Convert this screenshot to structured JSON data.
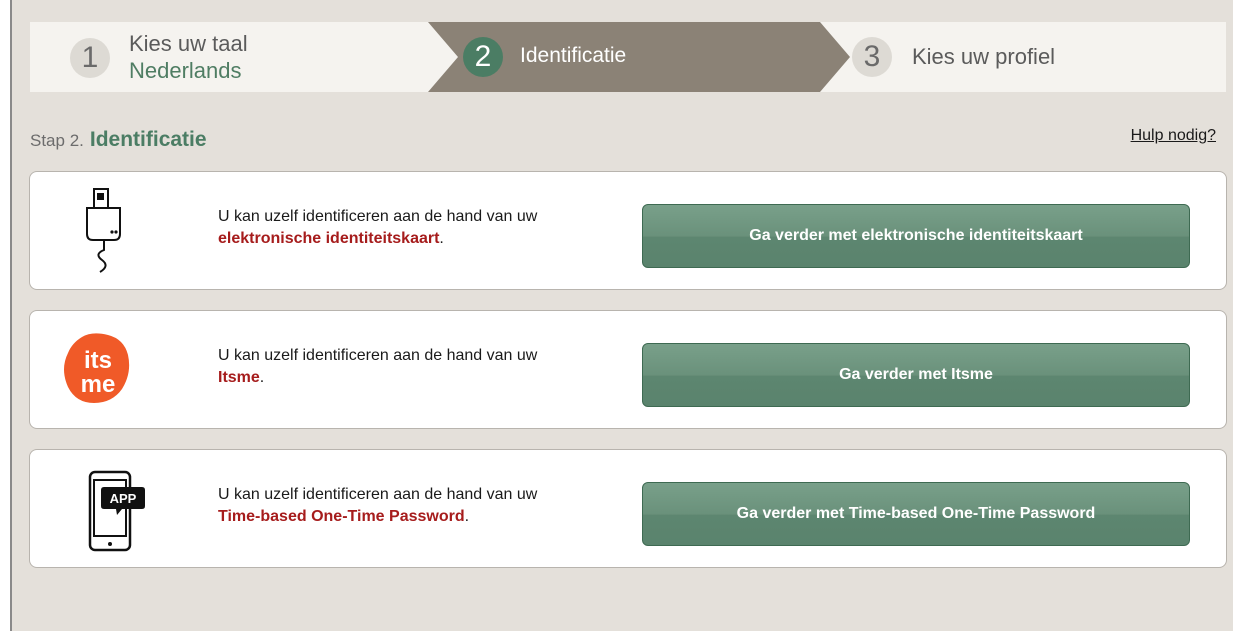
{
  "stepper": {
    "step1": {
      "number": "1",
      "label": "Kies uw taal",
      "value": "Nederlands"
    },
    "step2": {
      "number": "2",
      "label": "Identificatie"
    },
    "step3": {
      "number": "3",
      "label": "Kies uw profiel"
    }
  },
  "heading": {
    "prefix": "Stap 2.",
    "title": "Identificatie",
    "help": "Hulp nodig?"
  },
  "options": [
    {
      "icon": "card-reader-icon",
      "text": "U kan uzelf identificeren aan de hand van uw",
      "emphasis": "elektronische identiteitskaart",
      "suffix": ".",
      "button": "Ga verder met elektronische identiteitskaart"
    },
    {
      "icon": "itsme-logo",
      "logo_text_1": "its",
      "logo_text_2": "me",
      "text": "U kan uzelf identificeren aan de hand van uw",
      "emphasis": "Itsme",
      "suffix": ".",
      "button": "Ga verder met Itsme"
    },
    {
      "icon": "smartphone-app-icon",
      "app_label": "APP",
      "text": "U kan uzelf identificeren aan de hand van uw",
      "emphasis": "Time-based One-Time Password",
      "suffix": ".",
      "button": "Ga verder met Time-based One-Time Password"
    }
  ],
  "colors": {
    "accent": "#4b7d64",
    "emphasis": "#a61c1c",
    "background": "#e4e0da",
    "itsme": "#f05a28"
  }
}
